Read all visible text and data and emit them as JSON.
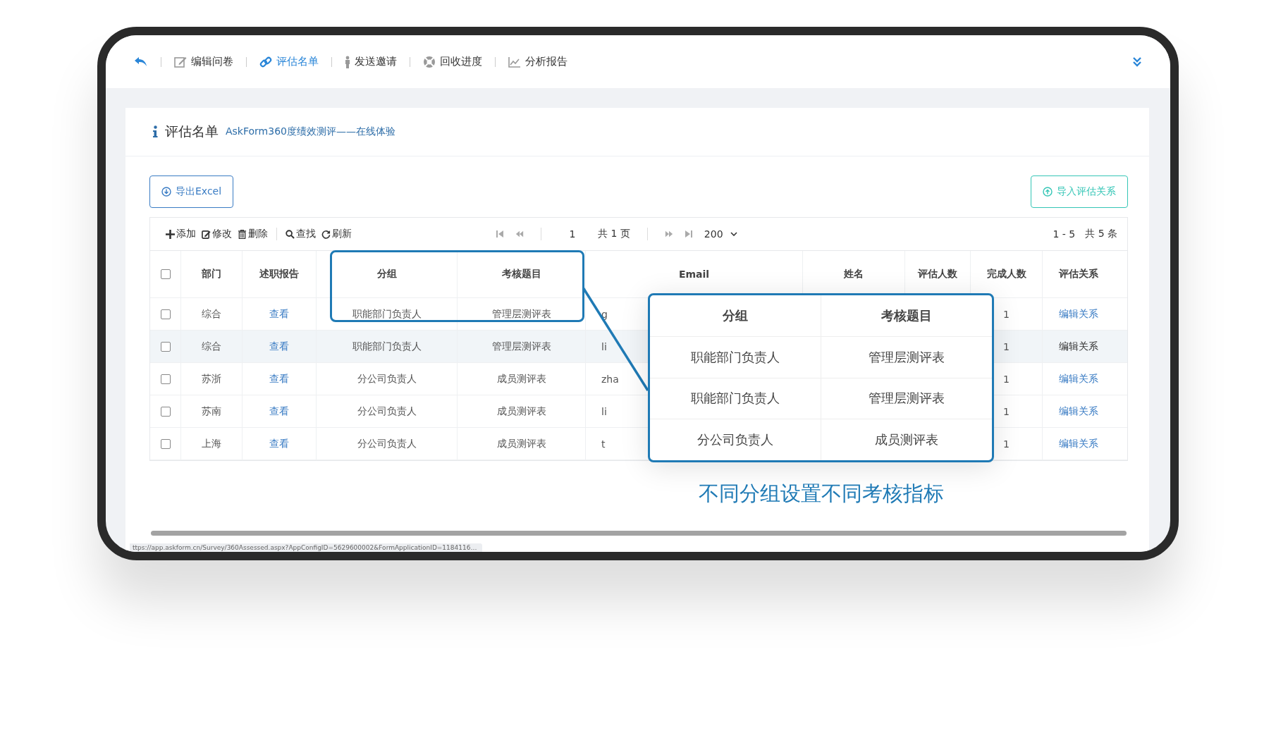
{
  "nav": {
    "items": [
      {
        "label": "编辑问卷",
        "selected": false
      },
      {
        "label": "评估名单",
        "selected": true
      },
      {
        "label": "发送邀请",
        "selected": false
      },
      {
        "label": "回收进度",
        "selected": false
      },
      {
        "label": "分析报告",
        "selected": false
      }
    ]
  },
  "card": {
    "title": "评估名单",
    "subtitle": "AskForm360度绩效测评——在线体验"
  },
  "buttons": {
    "export": "导出Excel",
    "import": "导入评估关系"
  },
  "toolbar": {
    "actions": [
      "添加",
      "修改",
      "删除",
      "查找",
      "刷新"
    ],
    "page": "1",
    "total_pages": "共 1 页",
    "page_size": "200",
    "range": "1 - 5",
    "total": "共 5 条"
  },
  "table": {
    "all_checked": false,
    "columns": [
      "部门",
      "述职报告",
      "分组",
      "考核题目",
      "Email",
      "姓名",
      "评估人数",
      "完成人数",
      "评估关系"
    ],
    "rows": [
      {
        "checked": false,
        "highlighted": false,
        "dept": "综合",
        "report": "查看",
        "group": "职能部门负责人",
        "subject": "管理层测评表",
        "email": "g",
        "completed": "1",
        "relation": "编辑关系"
      },
      {
        "checked": false,
        "highlighted": true,
        "dept": "综合",
        "report": "查看",
        "group": "职能部门负责人",
        "subject": "管理层测评表",
        "email": "li",
        "completed": "1",
        "relation": "编辑关系"
      },
      {
        "checked": false,
        "highlighted": false,
        "dept": "苏浙",
        "report": "查看",
        "group": "分公司负责人",
        "subject": "成员测评表",
        "email": "zha",
        "completed": "1",
        "relation": "编辑关系"
      },
      {
        "checked": false,
        "highlighted": false,
        "dept": "苏南",
        "report": "查看",
        "group": "分公司负责人",
        "subject": "成员测评表",
        "email": "li",
        "completed": "1",
        "relation": "编辑关系"
      },
      {
        "checked": false,
        "highlighted": false,
        "dept": "上海",
        "report": "查看",
        "group": "分公司负责人",
        "subject": "成员测评表",
        "email": "t",
        "completed": "1",
        "relation": "编辑关系"
      }
    ]
  },
  "callout": {
    "columns": [
      "分组",
      "考核题目"
    ],
    "rows": [
      [
        "职能部门负责人",
        "管理层测评表"
      ],
      [
        "职能部门负责人",
        "管理层测评表"
      ],
      [
        "分公司负责人",
        "成员测评表"
      ]
    ],
    "caption": "不同分组设置不同考核指标"
  },
  "status_bar": "ttps://app.askform.cn/Survey/360Assessed.aspx?AppConfigID=5629600002&FormApplicationID=1184116…"
}
